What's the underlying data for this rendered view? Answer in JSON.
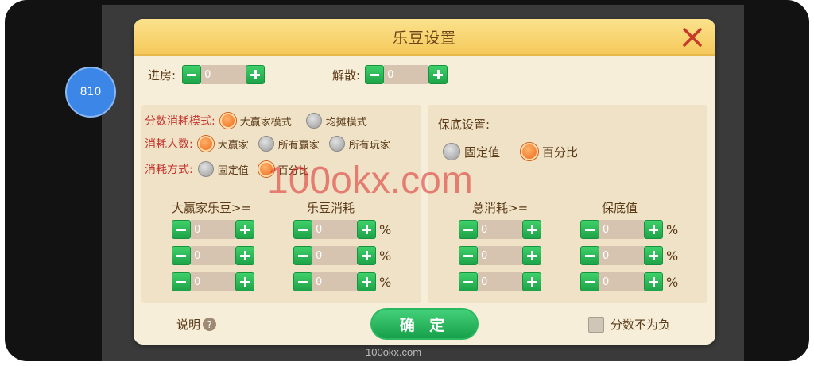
{
  "bubble": {
    "label": "810"
  },
  "dialog": {
    "title": "乐豆设置",
    "room": {
      "enter_label": "进房:",
      "enter_value": "0",
      "dissolve_label": "解散:",
      "dissolve_value": "0"
    },
    "left": {
      "score_mode_label": "分数消耗模式:",
      "score_mode_options": [
        "大赢家模式",
        "均摊模式"
      ],
      "score_mode_selected": "大赢家模式",
      "count_label": "消耗人数:",
      "count_options": [
        "大赢家",
        "所有赢家",
        "所有玩家"
      ],
      "count_selected": "大赢家",
      "method_label": "消耗方式:",
      "method_options": [
        "固定值",
        "百分比"
      ],
      "method_selected": "百分比",
      "col1_header": "大赢家乐豆>=",
      "col2_header": "乐豆消耗",
      "rows": [
        {
          "threshold": "0",
          "consume": "0",
          "unit": "%"
        },
        {
          "threshold": "0",
          "consume": "0",
          "unit": "%"
        },
        {
          "threshold": "0",
          "consume": "0",
          "unit": "%"
        }
      ]
    },
    "right": {
      "floor_label": "保底设置:",
      "floor_options": [
        "固定值",
        "百分比"
      ],
      "floor_selected": "百分比",
      "col1_header": "总消耗>=",
      "col2_header": "保底值",
      "rows": [
        {
          "threshold": "0",
          "floor": "0",
          "unit": "%"
        },
        {
          "threshold": "0",
          "floor": "0",
          "unit": "%"
        },
        {
          "threshold": "0",
          "floor": "0",
          "unit": "%"
        }
      ]
    },
    "footer": {
      "help_label": "说明",
      "help_icon": "?",
      "confirm_label": "确 定",
      "nonneg_label": "分数不为负"
    }
  },
  "watermark": {
    "main": "100okx.com",
    "footer": "100okx.com"
  },
  "colors": {
    "accent_green": "#1ea348",
    "title_bar": "#f5c95b",
    "radio_on": "#ef6a1c",
    "label_red": "#c4352d"
  }
}
